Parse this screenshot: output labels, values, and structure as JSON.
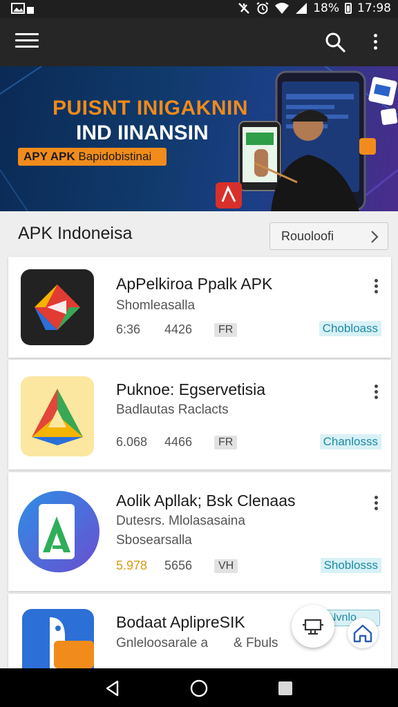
{
  "status_bar": {
    "battery_percent": "18%",
    "time": "17:98"
  },
  "banner": {
    "headline_1": "PUISNT INIGAKNIN",
    "headline_2": "IND IINANSIN",
    "pill_bold": "APY APK",
    "pill_text": "Bapidobistinai"
  },
  "section": {
    "title": "APK Indoneisa",
    "button_label": "Rouoloofi"
  },
  "apps": [
    {
      "title": "ApPelkiroa Ppalk APK",
      "subtitle": "Shomleasalla",
      "subtitle2": "",
      "stat_a": "6:36",
      "stat_b": "4426",
      "tag": "FR",
      "badge": "Chobloass"
    },
    {
      "title": "Puknoe: Egservetisia",
      "subtitle": "Badlautas Raclacts",
      "subtitle2": "",
      "stat_a": "6.068",
      "stat_b": "4466",
      "tag": "FR",
      "badge": "Chanlosss"
    },
    {
      "title": "Aolik Apllak; Bsk Clenaas",
      "subtitle": "Dutesrs. Mlolasasaina",
      "subtitle2": "Sbosearsalla",
      "stat_a": "5.978",
      "stat_b": "5656",
      "tag": "VH",
      "badge": "Shoblosss"
    },
    {
      "title": "Bodaat AplipreSIK",
      "subtitle": "Gnleloosarale a",
      "subtitle2": "& Fbuls",
      "stat_a": "",
      "stat_b": "",
      "tag": "",
      "badge": ""
    }
  ],
  "peek_badge": "Nvnlo",
  "colors": {
    "accent_orange": "#f18c1c",
    "badge_teal": "#1c8aa5",
    "badge_bg": "#d8f1f6",
    "app_bar": "#262626"
  },
  "icons": [
    "menu-icon",
    "search-icon",
    "more-vert-icon",
    "chevron-right-icon",
    "cast-icon",
    "home-icon",
    "back-icon",
    "circle-home-icon",
    "recents-icon"
  ]
}
